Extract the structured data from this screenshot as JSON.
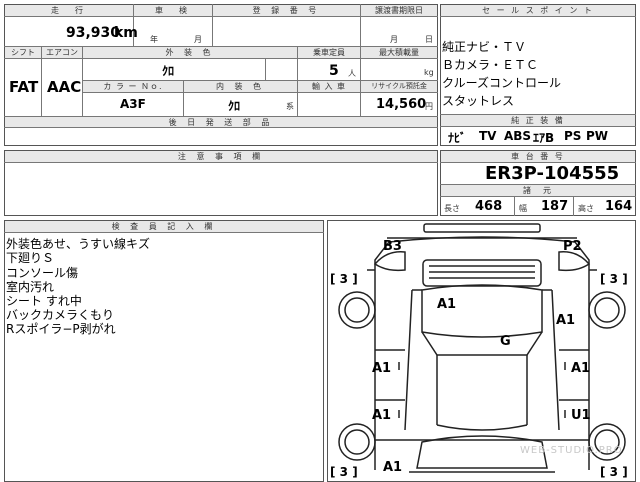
{
  "top": {
    "mileage_label": "走　行",
    "mileage_value": "93,930",
    "mileage_unit": "km",
    "inspection_label": "車　検",
    "inspection_year": "年",
    "inspection_month": "月",
    "registration_label": "登 録 番 号",
    "transfer_label": "譲渡書期限日",
    "transfer_month": "月",
    "transfer_day": "日"
  },
  "spec": {
    "shift_label": "シフト",
    "shift_value": "FAT",
    "aircon_label": "エアコン",
    "aircon_value": "AAC",
    "ext_color_label": "外 装 色",
    "ext_color_value": "ｸﾛ",
    "capacity_label": "乗車定員",
    "capacity_value": "5",
    "capacity_unit": "人",
    "load_label": "最大積載量",
    "load_unit": "kg",
    "color_no_label": "カ ラ ー Ｎｏ.",
    "color_no_value": "A3F",
    "int_color_label": "内 装 色",
    "int_color_value": "ｸﾛ",
    "int_color_unit": "系",
    "import_label": "輸 入 車",
    "recycle_label": "リサイクル預託金",
    "recycle_value": "14,560",
    "recycle_unit": "円"
  },
  "later_docs_label": "後 日 発 送 部 品",
  "notes_label": "注 意 事 項 欄",
  "sales": {
    "label": "セ ー ル ス ポ イ ン ト",
    "points": [
      "純正ナビ・ＴＶ",
      "Ｂカメラ・ＥＴＣ",
      "クルーズコントロール",
      "スタットレス"
    ]
  },
  "equipment": {
    "label": "純 正 装 備",
    "items": [
      "ﾅﾋﾞ",
      "TV",
      "ABS",
      "ｴｱB",
      "PS",
      "PW"
    ]
  },
  "chassis": {
    "label": "車 台 番 号",
    "value": "ER3P-104555"
  },
  "dims": {
    "label": "諸　元",
    "length_label": "長さ",
    "length_value": "468",
    "width_label": "幅",
    "width_value": "187",
    "height_label": "高さ",
    "height_value": "164"
  },
  "inspector": {
    "label": "検 査 員 記 入 欄",
    "lines": [
      "外装色あせ、うすい線キズ",
      "下廻りＳ",
      "コンソール傷",
      "室内汚れ",
      "シート すれ中",
      "バックカメラくもり",
      "Rスポイラ−P剥がれ"
    ]
  },
  "diagram": {
    "marks": {
      "b3": "B3",
      "p2": "P2",
      "a1_roof": "A1",
      "a1_right_top": "A1",
      "g": "G",
      "a1_left_front": "A1",
      "a1_left_rear": "A1",
      "a1_right_front": "A1",
      "u1": "U1",
      "a1_bottom": "A1",
      "tire_lt": "[ 3 ]",
      "tire_rt": "[ 3 ]",
      "tire_lb": "[ 3 ]",
      "tire_rb": "[ 3 ]"
    }
  },
  "watermark": "WEB-STUDIO.PRO"
}
